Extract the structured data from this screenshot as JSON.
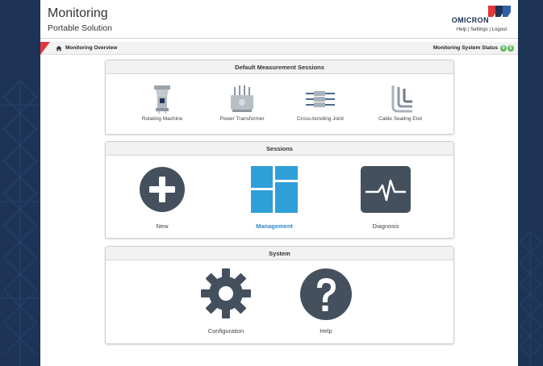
{
  "header": {
    "title": "Monitoring",
    "subtitle": "Portable Solution",
    "brand": "OMICRON",
    "links": [
      "Help",
      "Settings",
      "Logout"
    ],
    "link_separator": "|"
  },
  "breadcrumb": {
    "label": "Monitoring Overview"
  },
  "system_status": {
    "label": "Monitoring System Status",
    "indicators": [
      "0",
      "0"
    ],
    "color": "#5cb85c"
  },
  "panels": {
    "default_sessions": {
      "title": "Default Measurement Sessions",
      "items": [
        {
          "label": "Rotating Machine",
          "icon": "rotating-machine-icon"
        },
        {
          "label": "Power Transformer",
          "icon": "power-transformer-icon"
        },
        {
          "label": "Cross-bonding Joint",
          "icon": "cross-bonding-joint-icon"
        },
        {
          "label": "Cable Sealing End",
          "icon": "cable-sealing-end-icon"
        }
      ]
    },
    "sessions": {
      "title": "Sessions",
      "items": [
        {
          "label": "New",
          "icon": "plus-icon"
        },
        {
          "label": "Management",
          "icon": "grid-icon"
        },
        {
          "label": "Diagnosis",
          "icon": "pulse-icon"
        }
      ]
    },
    "system": {
      "title": "System",
      "items": [
        {
          "label": "Configuration",
          "icon": "gear-icon"
        },
        {
          "label": "Help",
          "icon": "question-icon"
        }
      ]
    }
  },
  "colors": {
    "accent": "#2f8ccb",
    "icon_dark": "#45505e",
    "brand_red": "#e0383d",
    "brand_navy": "#1d3457"
  }
}
